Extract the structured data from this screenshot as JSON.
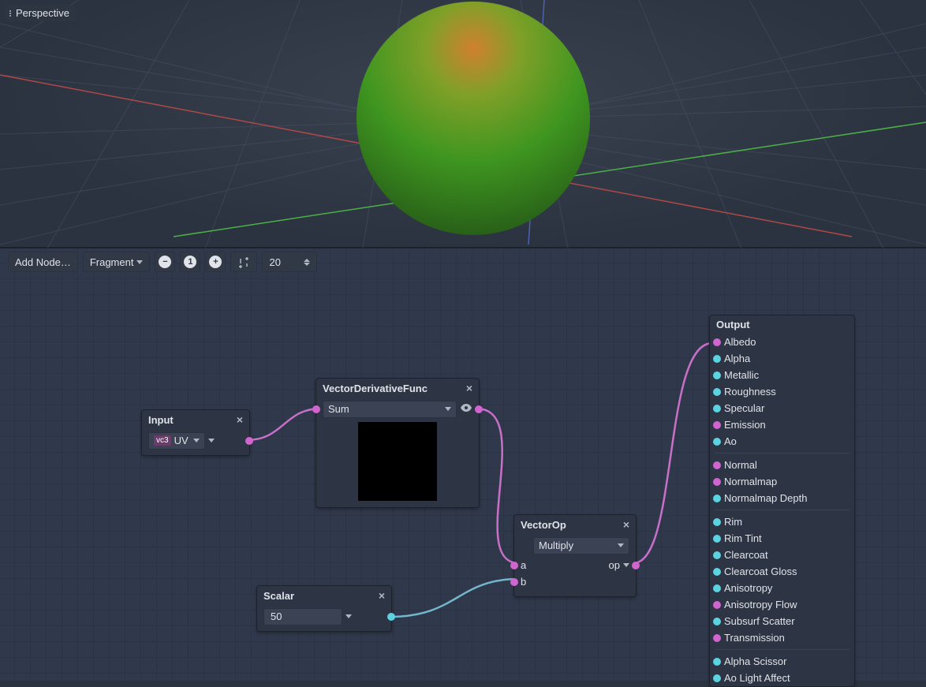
{
  "viewport": {
    "mode_label": "Perspective"
  },
  "toolbar": {
    "add_node_label": "Add Node…",
    "shader_stage": "Fragment",
    "grid_value": "20"
  },
  "nodes": {
    "input": {
      "title": "Input",
      "uv_label": "UV",
      "type_badge": "vc3"
    },
    "deriv": {
      "title": "VectorDerivativeFunc",
      "op": "Sum"
    },
    "scalar": {
      "title": "Scalar",
      "value": "50"
    },
    "vecop": {
      "title": "VectorOp",
      "op": "Multiply",
      "a_label": "a",
      "b_label": "b",
      "out_label": "op"
    },
    "output": {
      "title": "Output",
      "ports": [
        "Albedo",
        "Alpha",
        "Metallic",
        "Roughness",
        "Specular",
        "Emission",
        "Ao",
        "Normal",
        "Normalmap",
        "Normalmap Depth",
        "Rim",
        "Rim Tint",
        "Clearcoat",
        "Clearcoat Gloss",
        "Anisotropy",
        "Anisotropy Flow",
        "Subsurf Scatter",
        "Transmission",
        "Alpha Scissor",
        "Ao Light Affect"
      ]
    }
  }
}
